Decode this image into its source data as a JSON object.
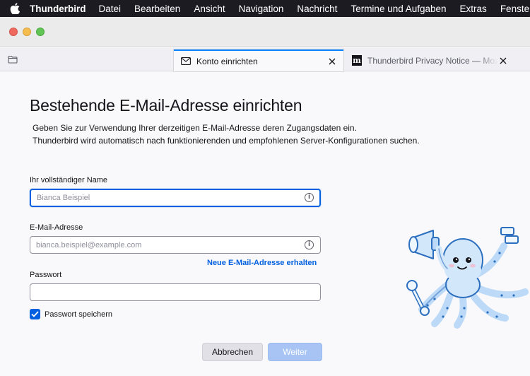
{
  "menubar": {
    "app_name": "Thunderbird",
    "items": [
      "Datei",
      "Bearbeiten",
      "Ansicht",
      "Navigation",
      "Nachricht",
      "Termine und Aufgaben",
      "Extras",
      "Fenster"
    ]
  },
  "tabs": [
    {
      "label": "Konto einrichten",
      "icon": "envelope-icon",
      "active": true
    },
    {
      "label": "Thunderbird Privacy Notice — Mozilla",
      "icon": "mozilla-m-icon",
      "active": false
    }
  ],
  "page": {
    "title": "Bestehende E-Mail-Adresse einrichten",
    "description_line1": "Geben Sie zur Verwendung Ihrer derzeitigen E-Mail-Adresse deren Zugangsdaten ein.",
    "description_line2": "Thunderbird wird automatisch nach funktionierenden und empfohlenen Server-Konfigurationen suchen."
  },
  "form": {
    "name_label": "Ihr vollständiger Name",
    "name_placeholder": "Bianca Beispiel",
    "name_value": "",
    "email_label": "E-Mail-Adresse",
    "email_placeholder": "bianca.beispiel@example.com",
    "email_value": "",
    "get_email_link": "Neue E-Mail-Adresse erhalten",
    "password_label": "Passwort",
    "password_value": "",
    "remember_password_label": "Passwort speichern",
    "remember_password_checked": true
  },
  "buttons": {
    "cancel": "Abbrechen",
    "continue": "Weiter"
  },
  "colors": {
    "accent": "#0060df",
    "tab_highlight": "#0a84ff",
    "disabled_primary": "#a7c4f4"
  }
}
